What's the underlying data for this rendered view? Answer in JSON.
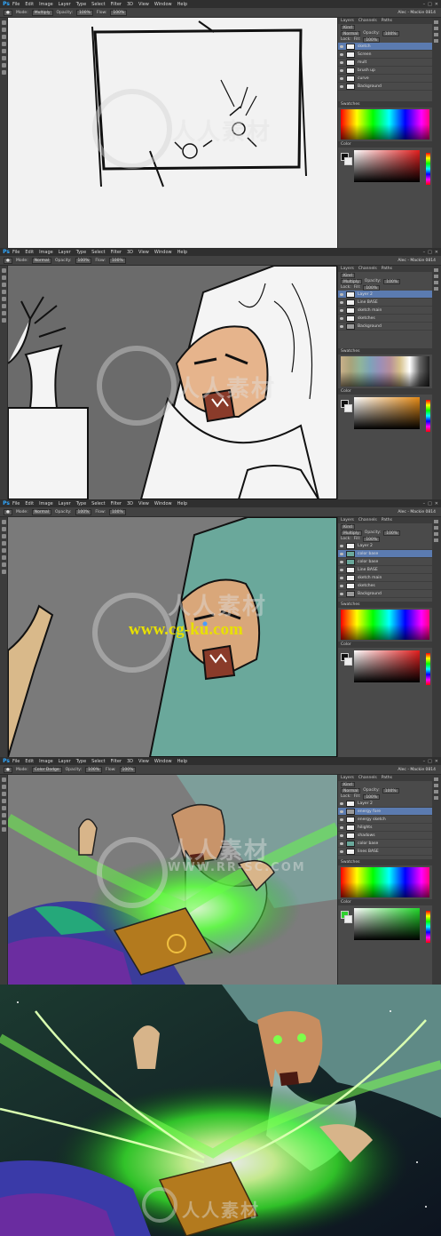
{
  "app": {
    "logo": "Ps",
    "menu": [
      "File",
      "Edit",
      "Image",
      "Layer",
      "Type",
      "Select",
      "Filter",
      "3D",
      "View",
      "Window",
      "Help"
    ],
    "document": "Alec - Mackie 0814",
    "window_controls": [
      "–",
      "□",
      "✕"
    ]
  },
  "panels": {
    "tabs": [
      "Layers",
      "Channels",
      "Paths"
    ],
    "kind_label": "Kind",
    "opacity_label": "Opacity:",
    "fill_label": "Fill:",
    "lock_label": "Lock:",
    "swatches_label": "Swatches",
    "color_label": "Color"
  },
  "frames": [
    {
      "mode": "Multiply",
      "opacity": "100%",
      "flow": "100%",
      "blend": "Normal",
      "layers": [
        "sketch",
        "Screen",
        "mult",
        "brush up",
        "curve",
        "Background"
      ]
    },
    {
      "mode": "Normal",
      "opacity": "100%",
      "flow": "100%",
      "blend": "Multiply",
      "layers": [
        "Layer 2",
        "Line BASE",
        "sketch main",
        "sketches",
        "Background"
      ]
    },
    {
      "mode": "Normal",
      "opacity": "100%",
      "flow": "100%",
      "blend": "Multiply",
      "layers": [
        "Layer 2",
        "color base",
        "color base",
        "Line BASE",
        "sketch main",
        "sketches",
        "Background"
      ]
    },
    {
      "mode": "Color Dodge",
      "opacity": "100%",
      "flow": "100%",
      "blend": "Normal",
      "layers": [
        "Layer 2",
        "energy fore",
        "energy sketch",
        "hilights",
        "shadows",
        "color base",
        "lines BASE"
      ]
    }
  ],
  "watermark": {
    "text": "人人素材",
    "url_text": "www.cg-ku.com",
    "domain_text": "WWW.RR-SC.COM"
  },
  "colors": {
    "ui_dark": "#2f2f2f",
    "ui_panel": "#4a4a4a",
    "selection": "#5b7bb0",
    "teal_fill": "#6aa89b",
    "magic_green": "#4cff3a",
    "url_yellow": "#e8e000"
  }
}
